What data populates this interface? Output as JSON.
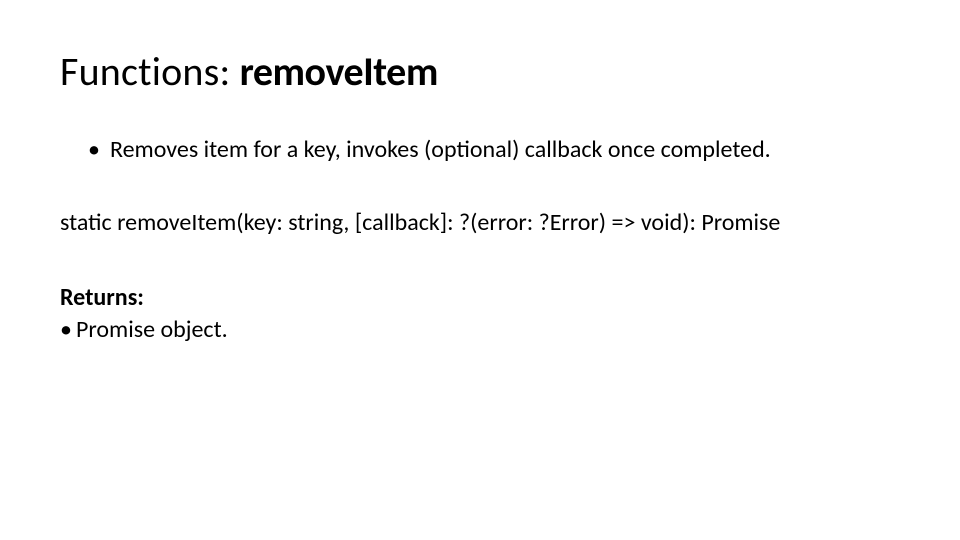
{
  "title": {
    "prefix": "Functions: ",
    "name": "removeItem"
  },
  "description_bullet": "Removes item for a key, invokes (optional) callback once completed.",
  "signature": "static removeItem(key: string, [callback]: ?(error: ?Error) => void): Promise",
  "returns": {
    "label": "Returns:",
    "bullet": "Promise object."
  }
}
